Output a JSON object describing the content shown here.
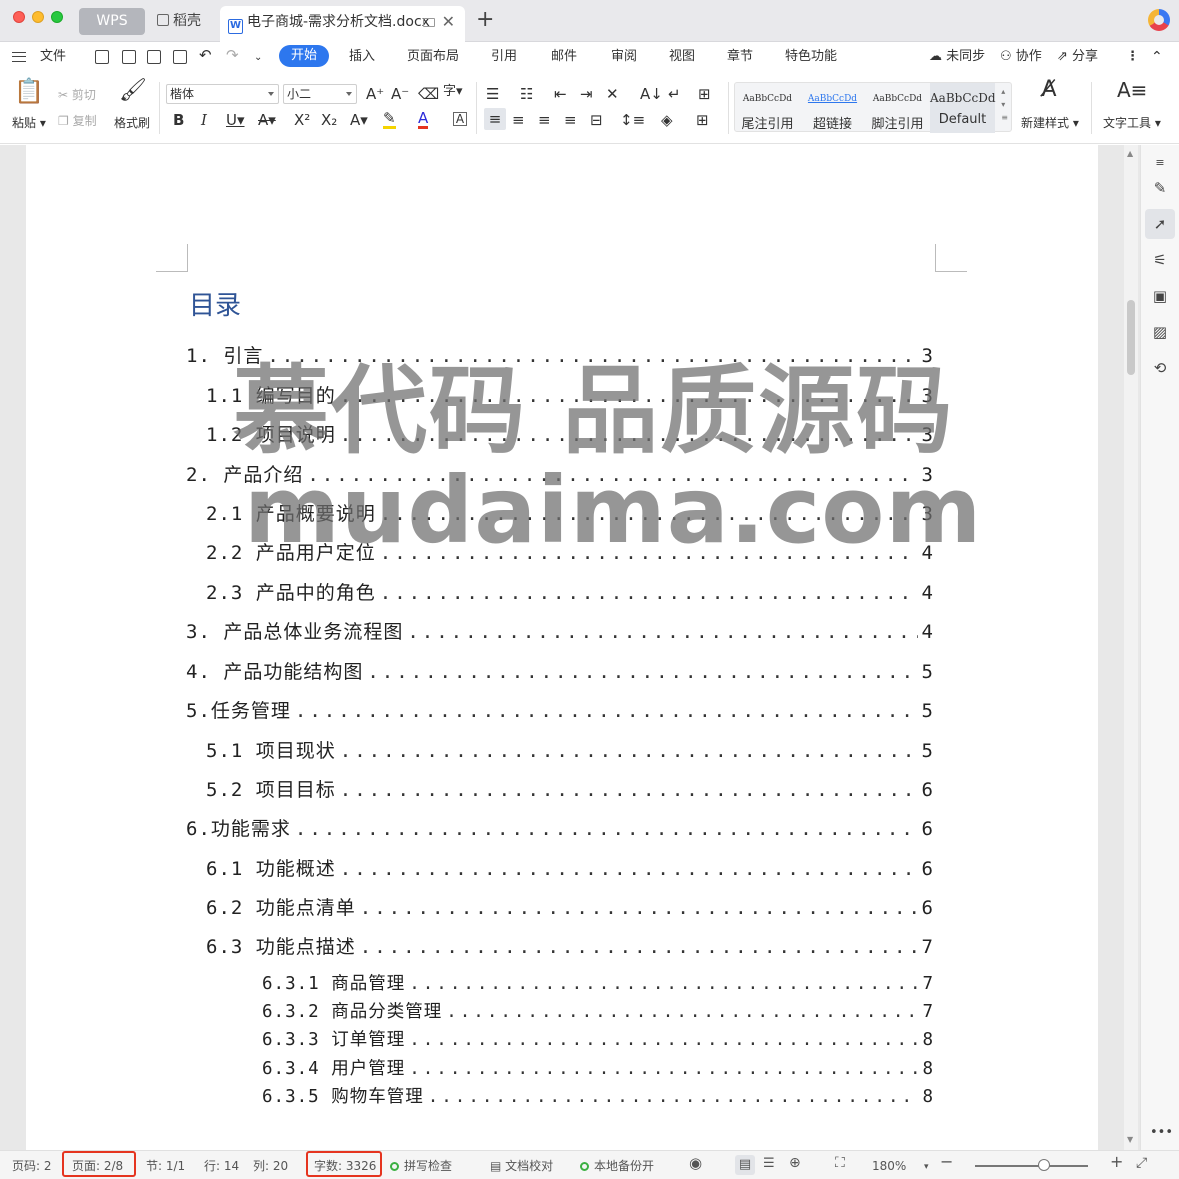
{
  "titlebar": {
    "tabs": [
      "WPS",
      "稻壳"
    ],
    "doc_tab_title": "电子商城-需求分析文档.docx",
    "new_tab": "+"
  },
  "menubar": {
    "file": "文件",
    "tabs": [
      "开始",
      "插入",
      "页面布局",
      "引用",
      "邮件",
      "审阅",
      "视图",
      "章节",
      "特色功能"
    ],
    "active_tab": "开始",
    "sync": "未同步",
    "collab": "协作",
    "share": "分享"
  },
  "ribbon": {
    "paste": "粘贴",
    "cut": "剪切",
    "copy": "复制",
    "format_painter": "格式刷",
    "font_name": "楷体",
    "font_size": "小二",
    "styles": [
      {
        "preview": "AaBbCcDd",
        "name": "尾注引用"
      },
      {
        "preview": "AaBbCcDd",
        "name": "超链接"
      },
      {
        "preview": "AaBbCcDd",
        "name": "脚注引用"
      },
      {
        "preview": "AaBbCcDd",
        "name": "Default"
      }
    ],
    "new_style": "新建样式",
    "text_tools": "文字工具"
  },
  "document": {
    "toc_title": "目录",
    "toc": [
      {
        "level": 1,
        "title": "1. 引言",
        "page": "3"
      },
      {
        "level": 2,
        "title": "1.1 编写目的",
        "page": "3"
      },
      {
        "level": 2,
        "title": "1.2 项目说明",
        "page": "3"
      },
      {
        "level": 1,
        "title": "2. 产品介绍",
        "page": "3"
      },
      {
        "level": 2,
        "title": "2.1 产品概要说明",
        "page": "3"
      },
      {
        "level": 2,
        "title": "2.2 产品用户定位",
        "page": "4"
      },
      {
        "level": 2,
        "title": "2.3 产品中的角色",
        "page": "4"
      },
      {
        "level": 1,
        "title": "3. 产品总体业务流程图",
        "page": "4"
      },
      {
        "level": 1,
        "title": "4. 产品功能结构图",
        "page": "5"
      },
      {
        "level": 1,
        "title": "5.任务管理",
        "page": "5"
      },
      {
        "level": 2,
        "title": "5.1 项目现状",
        "page": "5"
      },
      {
        "level": 2,
        "title": "5.2 项目目标",
        "page": "6"
      },
      {
        "level": 1,
        "title": "6.功能需求",
        "page": "6"
      },
      {
        "level": 2,
        "title": "6.1 功能概述",
        "page": "6"
      },
      {
        "level": 2,
        "title": "6.2 功能点清单",
        "page": "6"
      },
      {
        "level": 2,
        "title": "6.3 功能点描述",
        "page": "7"
      },
      {
        "level": 3,
        "title": "6.3.1 商品管理",
        "page": "7"
      },
      {
        "level": 3,
        "title": "6.3.2 商品分类管理",
        "page": "7"
      },
      {
        "level": 3,
        "title": "6.3.3 订单管理",
        "page": "8"
      },
      {
        "level": 3,
        "title": "6.3.4 用户管理",
        "page": "8"
      },
      {
        "level": 3,
        "title": "6.3.5 购物车管理",
        "page": "8"
      }
    ],
    "watermark_line1": "慕代码 品质源码",
    "watermark_line2": "mudaima.com"
  },
  "statusbar": {
    "page_num": "页码: 2",
    "page": "页面: 2/8",
    "section": "节: 1/1",
    "row": "行: 14",
    "col": "列: 20",
    "word_count": "字数: 3326",
    "spell_check": "拼写检查",
    "doc_proof": "文档校对",
    "local_backup": "本地备份开",
    "zoom": "180%",
    "highlight_color": "#e5341f"
  }
}
